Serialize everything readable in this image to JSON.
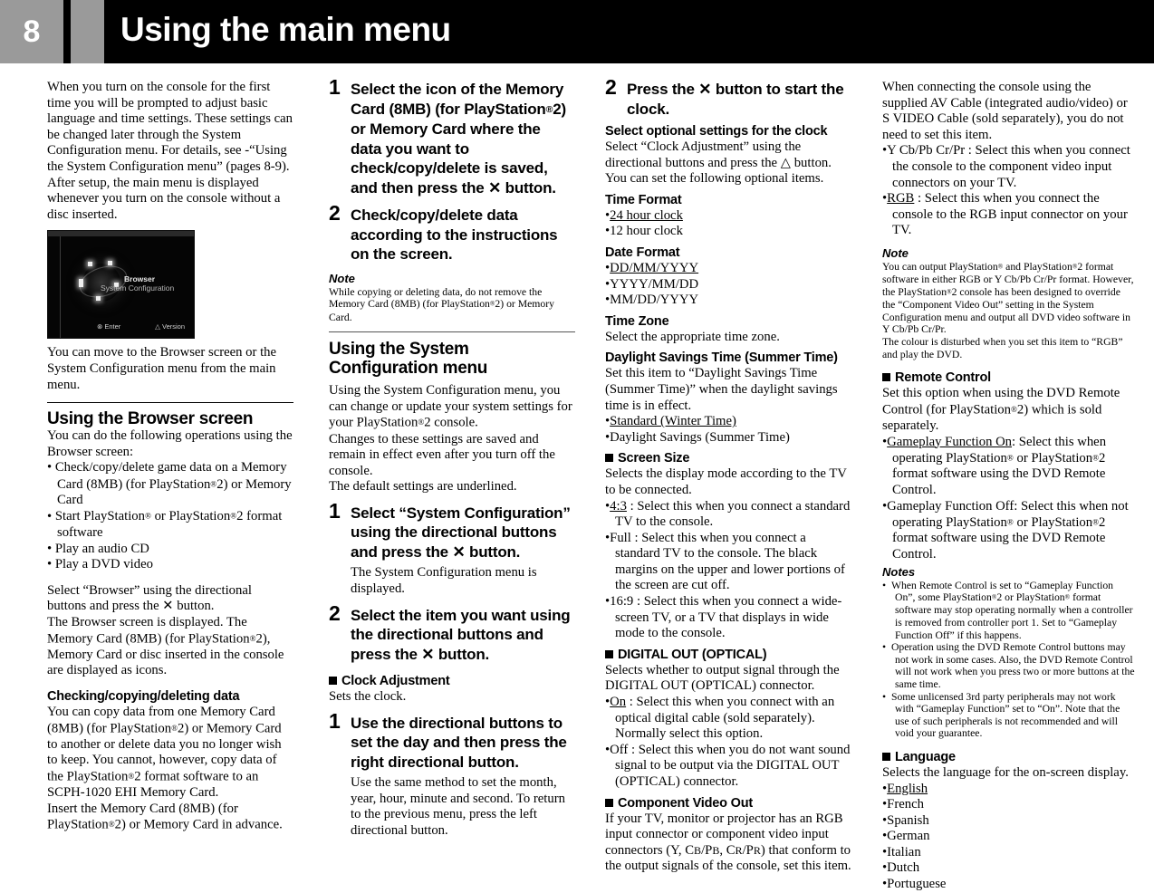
{
  "header": {
    "page_number": "8",
    "title": "Using the main menu"
  },
  "column1": {
    "intro": "When you turn on the console for the first time you will be prompted to adjust basic language and time settings. These settings can be changed later through the System Configuration menu. For details, see -“Using the System Configuration menu” (pages 8-9). After setup, the main menu is displayed whenever you turn on the console without a disc inserted.",
    "figure": {
      "label_browser": "Browser",
      "label_sysconfig": "System Configuration",
      "footer_left": "⊗ Enter",
      "footer_right": "△ Version"
    },
    "after_figure": "You can move to the Browser screen or the System Configuration menu from the main menu.",
    "browser_heading": "Using the Browser screen",
    "browser_intro": "You can do the following operations using the Browser screen:",
    "browser_bullets": [
      "Check/copy/delete game data on a Memory Card (8MB) (for PlayStation®2) or Memory Card",
      "Start PlayStation® or PlayStation®2 format software",
      "Play an audio CD",
      "Play a DVD video"
    ],
    "browser_select": "Select “Browser” using the directional buttons and press the ✕ button.",
    "browser_displayed": "The Browser screen is displayed. The Memory Card (8MB) (for PlayStation®2), Memory Card or disc inserted in the console are displayed as icons.",
    "check_heading": "Checking/copying/deleting data",
    "check_body1": "You can copy data from one Memory Card (8MB) (for PlayStation®2) or Memory Card to another or delete data you no longer wish to keep. You cannot, however, copy data of the PlayStation®2 format software to an SCPH-1020 EHI Memory Card.",
    "check_body2": "Insert the Memory Card (8MB) (for PlayStation®2) or Memory Card in advance."
  },
  "column2": {
    "step1_num": "1",
    "step1_text": "Select the icon of the Memory Card (8MB) (for PlayStation®2) or Memory Card where the data you want to check/copy/delete is saved, and then press the ✕ button.",
    "step2_num": "2",
    "step2_text": "Check/copy/delete data according to the instructions on the screen.",
    "note_heading": "Note",
    "note_body": "While copying or deleting data, do not remove the Memory Card (8MB) (for PlayStation®2) or Memory Card.",
    "sysconfig_heading": "Using the System Configuration menu",
    "sysconfig_p1": "Using the System Configuration menu, you can change or update your system settings for your PlayStation®2 console.",
    "sysconfig_p2": "Changes to these settings are saved and remain in effect even after you turn off the console.",
    "sysconfig_p3": "The default settings are underlined.",
    "sc_step1_num": "1",
    "sc_step1_text": "Select “System Configuration” using the directional buttons and press the ✕ button.",
    "sc_step1_sub": "The System Configuration menu is displayed.",
    "sc_step2_num": "2",
    "sc_step2_text": "Select the item you want using the directional buttons and press the ✕ button.",
    "clock_heading": "Clock Adjustment",
    "clock_sub": "Sets the clock.",
    "clock_step1_num": "1",
    "clock_step1_text": "Use the directional buttons to set the day and then press the right directional button.",
    "clock_step1_sub": "Use the same method to set the month, year, hour, minute and second. To return to the previous menu, press the left directional button."
  },
  "column3": {
    "step2_num": "2",
    "step2_text": "Press the ✕ button to start the clock.",
    "optional_heading": "Select optional settings for the clock",
    "optional_body": "Select “Clock Adjustment” using the directional buttons and press the △ button. You can set the following optional items.",
    "time_format_heading": "Time Format",
    "time_format_options": [
      "24 hour clock",
      "12 hour clock"
    ],
    "time_format_default": "24 hour clock",
    "date_format_heading": "Date Format",
    "date_format_options": [
      "DD/MM/YYYY",
      "YYYY/MM/DD",
      "MM/DD/YYYY"
    ],
    "date_format_default": "DD/MM/YYYY",
    "time_zone_heading": "Time Zone",
    "time_zone_body": "Select the appropriate time zone.",
    "dst_heading": "Daylight Savings Time (Summer Time)",
    "dst_body": "Set this item to “Daylight Savings Time (Summer Time)” when the daylight savings time is in effect.",
    "dst_options": [
      "Standard (Winter Time)",
      "Daylight Savings (Summer Time)"
    ],
    "dst_default": "Standard (Winter Time)",
    "screen_size_heading": "Screen Size",
    "screen_size_body": "Selects the display mode according to the TV to be connected.",
    "screen_size_options": [
      {
        "label": "4:3",
        "text": " : Select this when you connect a standard TV to the console.",
        "default": true
      },
      {
        "label": "Full",
        "text": " : Select this when you connect a standard TV to the console. The black margins on the upper and lower portions of the screen are cut off.",
        "default": false
      },
      {
        "label": "16:9",
        "text": " : Select this when you connect a wide-screen TV, or a TV that displays in wide mode to the console.",
        "default": false
      }
    ],
    "digital_out_heading": "DIGITAL OUT (OPTICAL)",
    "digital_out_body": "Selects whether to output signal through the DIGITAL OUT (OPTICAL) connector.",
    "digital_out_options": [
      {
        "label": "On",
        "text": " : Select this when you connect with an optical digital cable (sold separately). Normally select this option.",
        "default": true
      },
      {
        "label": "Off",
        "text": " : Select this when you do not want sound signal to be output via the DIGITAL OUT (OPTICAL) connector.",
        "default": false
      }
    ],
    "component_heading": "Component Video Out",
    "component_body": "If your TV, monitor or projector has an RGB input connector or component video input connectors (Y, CB/PB, CR/PR) that conform to the output signals of the console, set this item."
  },
  "column4": {
    "intro": "When connecting the console using the supplied AV Cable (integrated audio/video) or S VIDEO Cable (sold separately), you do not need to set this item.",
    "cvo_options": [
      {
        "label": "Y Cb/Pb Cr/Pr",
        "text": " : Select this when you connect the console to the component video input connectors on your TV.",
        "default": false
      },
      {
        "label": "RGB",
        "text": " : Select this when you connect the console to the RGB input connector on your TV.",
        "default": true
      }
    ],
    "note_heading": "Note",
    "note_lines": [
      "You can output PlayStation® and PlayStation®2 format software in either RGB or Y Cb/Pb Cr/Pr format. However, the PlayStation®2 console has been designed to override the “Component Video Out” setting in the System Configuration menu and output all DVD video software in Y Cb/Pb Cr/Pr.",
      "The colour is disturbed when you set this item to “RGB” and play the DVD."
    ],
    "remote_heading": "Remote Control",
    "remote_body": "Set this option when using the DVD Remote Control (for PlayStation®2) which is sold separately.",
    "remote_options": [
      {
        "label": "Gameplay Function On",
        "text": ": Select this when operating PlayStation® or PlayStation®2 format software using the DVD Remote Control.",
        "default": true
      },
      {
        "label": "Gameplay Function Off",
        "text": ": Select this when not operating PlayStation® or PlayStation®2 format software using the DVD Remote Control.",
        "default": false
      }
    ],
    "notes_heading": "Notes",
    "notes": [
      "When Remote Control is set to “Gameplay Function On”, some PlayStation®2 or PlayStation® format software may stop operating normally when a controller is removed from controller port 1. Set to “Gameplay Function Off” if this happens.",
      "Operation using the DVD Remote Control buttons may not work in some cases. Also, the DVD Remote Control will not work when you press two or more buttons at the same time.",
      "Some unlicensed 3rd party peripherals may not work with “Gameplay Function” set to “On”. Note that the use of such peripherals is not recommended and will void your guarantee."
    ],
    "language_heading": "Language",
    "language_body": "Selects the language for the on-screen display.",
    "language_options": [
      "English",
      "French",
      "Spanish",
      "German",
      "Italian",
      "Dutch",
      "Portuguese"
    ],
    "language_default": "English"
  }
}
